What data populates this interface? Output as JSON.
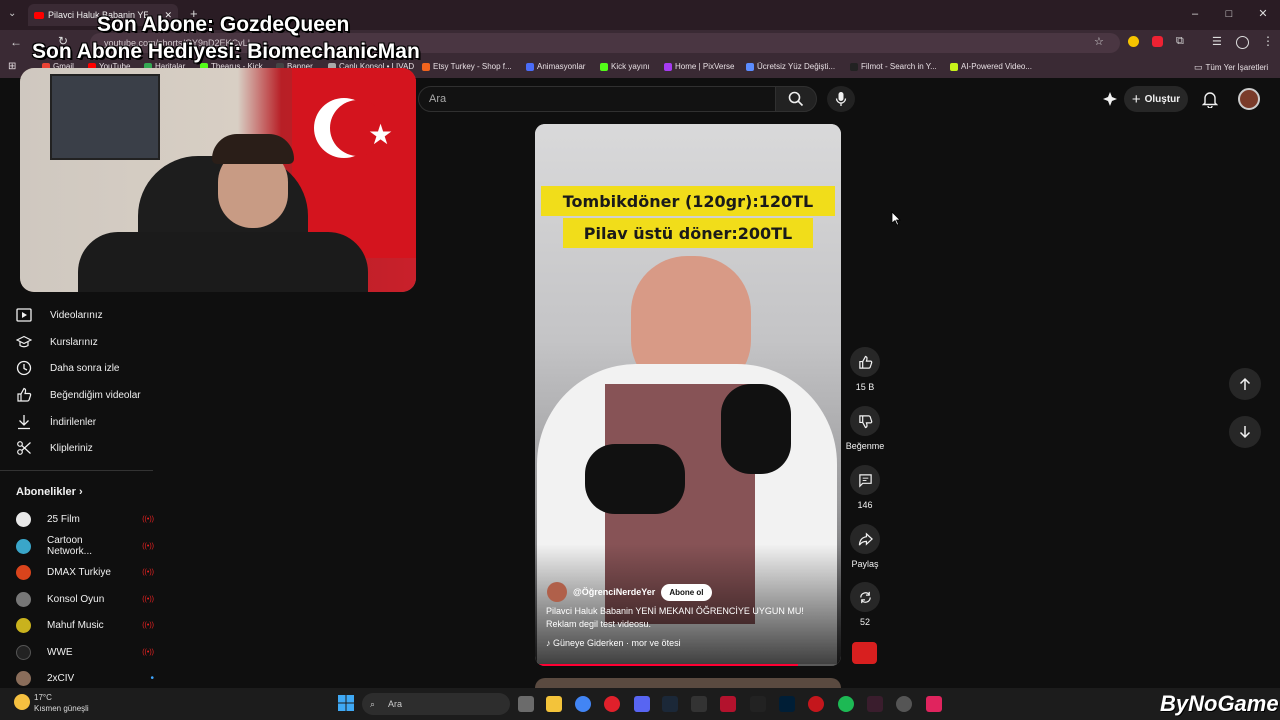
{
  "browser": {
    "tab_title": "Pilavci Haluk Babanin YENİ",
    "url": "youtube.com/shorts/OY9nD2EKCvLI",
    "window_controls": [
      "–",
      "□",
      "✕"
    ]
  },
  "bookmarks": {
    "items": [
      "Gmail",
      "YouTube",
      "Haritalar",
      "Thearus - Kick",
      "Banner",
      "Canlı Konsol • LIVAD",
      "Etsy Turkey - Shop f...",
      "Animasyonlar",
      "Kick yayını",
      "Home | PixVerse",
      "Ücretsiz Yüz Değişti...",
      "Filmot - Search in Y...",
      "AI-Powered Video..."
    ],
    "all_bookmarks": "Tüm Yer İşaretleri"
  },
  "header": {
    "search_placeholder": "Ara",
    "create_label": "Oluştur"
  },
  "overlay": {
    "line1": "Son Abone: GozdeQueen",
    "line2": "Son Abone Hediyesi: BiomechanicMan"
  },
  "sidebar": {
    "items": [
      {
        "label": "Videolarınız",
        "icon": "play-box-icon"
      },
      {
        "label": "Kurslarınız",
        "icon": "graduation-cap-icon"
      },
      {
        "label": "Daha sonra izle",
        "icon": "clock-icon"
      },
      {
        "label": "Beğendiğim videolar",
        "icon": "thumb-up-icon"
      },
      {
        "label": "İndirilenler",
        "icon": "download-icon"
      },
      {
        "label": "Klipleriniz",
        "icon": "scissors-icon"
      }
    ],
    "subscriptions_title": "Abonelikler",
    "subscriptions": [
      {
        "name": "25 Film",
        "color": "#e8e8e8",
        "badge": "live"
      },
      {
        "name": "Cartoon Network...",
        "color": "#3aa6c9",
        "badge": "live"
      },
      {
        "name": "DMAX Turkiye",
        "color": "#d9441c",
        "badge": "live"
      },
      {
        "name": "Konsol Oyun",
        "color": "#777777",
        "badge": "live"
      },
      {
        "name": "Mahuf Music",
        "color": "#c9b21d",
        "badge": "live"
      },
      {
        "name": "WWE",
        "color": "#222222",
        "badge": "live"
      },
      {
        "name": "2xCIV",
        "color": "#8a6d5a",
        "badge": "dot"
      }
    ],
    "live_glyph": "((•))",
    "dot_glyph": "•"
  },
  "short": {
    "caption_line1": "Tombikdöner (120gr):120TL",
    "caption_line2": "Pilav üstü döner:200TL",
    "channel": "@ÖğrenciNerdeYer",
    "subscribe_label": "Abone ol",
    "title": "Pilavci Haluk Babanin YENİ MEKANI ÖĞRENCİYE UYGUN MU! Reklam degil test videosu.",
    "music": "Güneye Giderken · mor ve ötesi",
    "progress": 0.86
  },
  "actions": {
    "likes": "15 B",
    "dislike_label": "Beğenme",
    "comments": "146",
    "share_label": "Paylaş",
    "remix": "52"
  },
  "taskbar": {
    "temperature": "17°C",
    "weather": "Kısmen güneşli",
    "search": "Ara",
    "watermark": "ByNoGame"
  },
  "colors": {
    "accent": "#ff0033",
    "background": "#0f0f0f",
    "browser_chrome": "#3a2a34",
    "caption_highlight": "#f1dd1a"
  }
}
